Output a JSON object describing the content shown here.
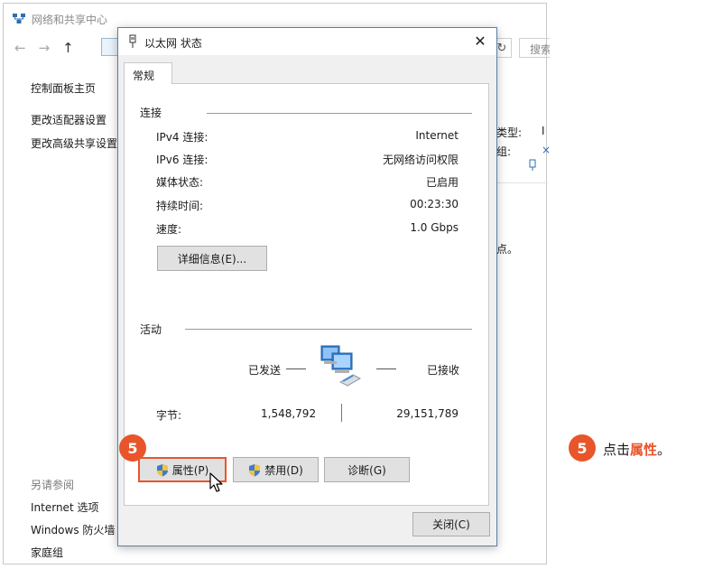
{
  "background_window": {
    "title": "网络和共享中心",
    "search_placeholder": "搜索",
    "left_links": [
      "控制面板主页",
      "更改适配器设置",
      "更改高级共享设置"
    ],
    "see_also_title": "另请参阅",
    "see_also_links": [
      "Internet 选项",
      "Windows 防火墙",
      "家庭组"
    ],
    "right_fragments": [
      "类型:",
      "I",
      "组:",
      "×",
      "点。"
    ]
  },
  "dialog": {
    "title": "以太网 状态",
    "close_glyph": "✕",
    "tab_label": "常规",
    "connection_section": "连接",
    "connection_rows": [
      {
        "label": "IPv4 连接:",
        "value": "Internet"
      },
      {
        "label": "IPv6 连接:",
        "value": "无网络访问权限"
      },
      {
        "label": "媒体状态:",
        "value": "已启用"
      },
      {
        "label": "持续时间:",
        "value": "00:23:30"
      },
      {
        "label": "速度:",
        "value": "1.0 Gbps"
      }
    ],
    "details_button": "详细信息(E)...",
    "activity_section": "活动",
    "sent_label": "已发送",
    "received_label": "已接收",
    "bytes_label": "字节:",
    "bytes_sent": "1,548,792",
    "bytes_received": "29,151,789",
    "properties_button": "属性(P)",
    "disable_button": "禁用(D)",
    "diagnose_button": "诊断(G)",
    "close_button": "关闭(C)"
  },
  "annotation": {
    "step_number": "5",
    "instruction_prefix": "点击",
    "instruction_highlight": "属性",
    "instruction_suffix": "。"
  },
  "colors": {
    "accent": "#e8552a",
    "dialog_border": "#5a7fa7"
  }
}
